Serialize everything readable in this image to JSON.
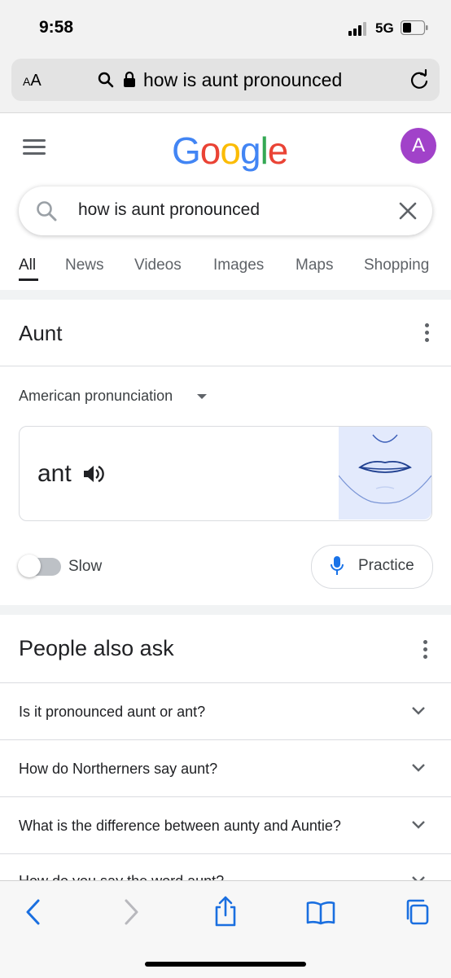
{
  "status_bar": {
    "time": "9:58",
    "network": "5G"
  },
  "browser": {
    "text_size_label_small": "A",
    "text_size_label_large": "A",
    "url": "how is aunt pronounced"
  },
  "header": {
    "logo_letters": [
      {
        "ch": "G",
        "color": "#4285F4"
      },
      {
        "ch": "o",
        "color": "#EA4335"
      },
      {
        "ch": "o",
        "color": "#FBBC05"
      },
      {
        "ch": "g",
        "color": "#4285F4"
      },
      {
        "ch": "l",
        "color": "#34A853"
      },
      {
        "ch": "e",
        "color": "#EA4335"
      }
    ],
    "avatar_letter": "A",
    "avatar_color": "#a142c9"
  },
  "search": {
    "query": "how is aunt pronounced"
  },
  "tabs": [
    "All",
    "News",
    "Videos",
    "Images",
    "Maps",
    "Shopping"
  ],
  "pronunciation_card": {
    "title": "Aunt",
    "accent": "American pronunciation",
    "word": "ant",
    "slow_label": "Slow",
    "practice_label": "Practice"
  },
  "people_also_ask": {
    "title": "People also ask",
    "questions": [
      "Is it pronounced aunt or ant?",
      "How do Northerners say aunt?",
      "What is the difference between aunty and Auntie?",
      "How do you say the word aunt?"
    ]
  },
  "colors": {
    "accent_blue": "#1a73e8",
    "ios_blue": "#1a6fe0"
  }
}
